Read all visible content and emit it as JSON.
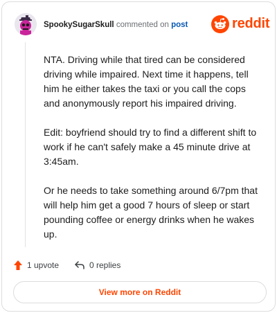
{
  "header": {
    "username": "SpookySugarSkull",
    "action": "commented on",
    "target": "post",
    "brand": "reddit",
    "avatar_icon": "skull-avatar-icon",
    "brand_icon": "reddit-alien-icon"
  },
  "comment": {
    "paragraphs": [
      "NTA. Driving while that tired can be considered driving while impaired. Next time it happens, tell him he either takes the taxi or you call the cops and anonymously report his impaired driving.",
      "Edit: boyfriend should try to find a different shift to work if he can't safely make a 45 minute drive at 3:45am.",
      "Or he needs to take something around 6/7pm that will help him get a good 7 hours of sleep or start pounding coffee or energy drinks when he wakes up."
    ]
  },
  "footer": {
    "upvotes": "1 upvote",
    "replies": "0 replies",
    "upvote_icon": "upvote-arrow-icon",
    "reply_icon": "reply-arrow-icon"
  },
  "cta": {
    "label": "View more on Reddit"
  },
  "colors": {
    "brand": "#ff4500",
    "link": "#0a58b4",
    "text": "#1c1c1c",
    "muted": "#6b6f73"
  }
}
